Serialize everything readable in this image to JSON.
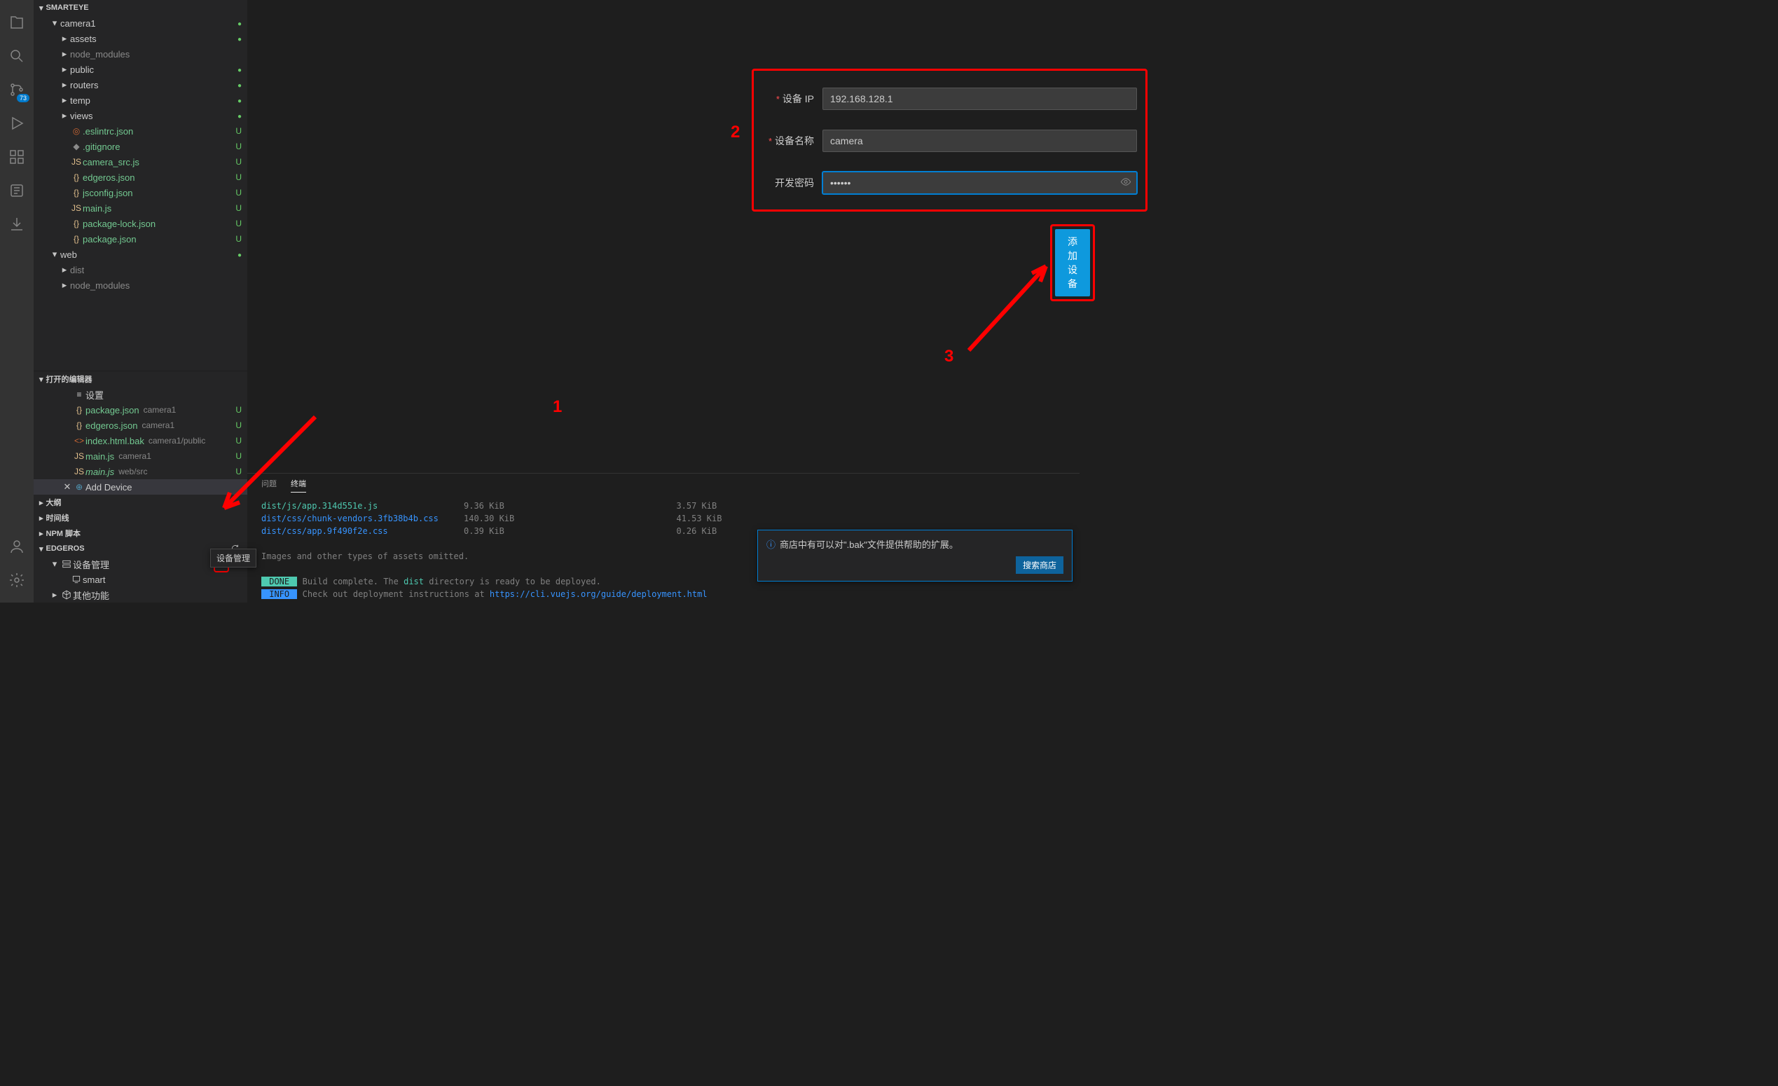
{
  "activity": {
    "source_control_badge": "73"
  },
  "annotations": {
    "n1": "1",
    "n2": "2",
    "n3": "3"
  },
  "explorer": {
    "root_name": "SMARTEYE",
    "tree": [
      {
        "depth": 1,
        "expand": "down",
        "label": "camera1",
        "status": "dot"
      },
      {
        "depth": 2,
        "expand": "right",
        "label": "assets",
        "status": "dot"
      },
      {
        "depth": 2,
        "expand": "right",
        "label": "node_modules",
        "cls": "clr-gray"
      },
      {
        "depth": 2,
        "expand": "right",
        "label": "public",
        "status": "dot"
      },
      {
        "depth": 2,
        "expand": "right",
        "label": "routers",
        "status": "dot"
      },
      {
        "depth": 2,
        "expand": "right",
        "label": "temp",
        "status": "dot"
      },
      {
        "depth": 2,
        "expand": "right",
        "label": "views",
        "status": "dot"
      },
      {
        "depth": 2,
        "icon": "◎",
        "iconcls": "clr-orange",
        "label": ".eslintrc.json",
        "status": "U",
        "cls": "clr-green"
      },
      {
        "depth": 2,
        "icon": "◆",
        "iconcls": "clr-gray",
        "label": ".gitignore",
        "status": "U",
        "cls": "clr-green"
      },
      {
        "depth": 2,
        "icon": "JS",
        "iconcls": "clr-yellow",
        "label": "camera_src.js",
        "status": "U",
        "cls": "clr-green"
      },
      {
        "depth": 2,
        "icon": "{}",
        "iconcls": "clr-bracket",
        "label": "edgeros.json",
        "status": "U",
        "cls": "clr-green"
      },
      {
        "depth": 2,
        "icon": "{}",
        "iconcls": "clr-bracket",
        "label": "jsconfig.json",
        "status": "U",
        "cls": "clr-green"
      },
      {
        "depth": 2,
        "icon": "JS",
        "iconcls": "clr-yellow",
        "label": "main.js",
        "status": "U",
        "cls": "clr-green"
      },
      {
        "depth": 2,
        "icon": "{}",
        "iconcls": "clr-bracket",
        "label": "package-lock.json",
        "status": "U",
        "cls": "clr-green"
      },
      {
        "depth": 2,
        "icon": "{}",
        "iconcls": "clr-bracket",
        "label": "package.json",
        "status": "U",
        "cls": "clr-green"
      },
      {
        "depth": 1,
        "expand": "down",
        "label": "web",
        "status": "dot"
      },
      {
        "depth": 2,
        "expand": "right",
        "label": "dist",
        "cls": "clr-gray"
      },
      {
        "depth": 2,
        "expand": "right",
        "label": "node_modules",
        "cls": "clr-gray"
      }
    ]
  },
  "open_editors": {
    "header": "打开的编辑器",
    "items": [
      {
        "icon": "≡",
        "label": "设置"
      },
      {
        "icon": "{}",
        "iconcls": "clr-bracket",
        "label": "package.json",
        "sub": "camera1",
        "status": "U",
        "cls": "clr-green"
      },
      {
        "icon": "{}",
        "iconcls": "clr-bracket",
        "label": "edgeros.json",
        "sub": "camera1",
        "status": "U",
        "cls": "clr-green"
      },
      {
        "icon": "<>",
        "iconcls": "clr-orange",
        "label": "index.html.bak",
        "sub": "camera1/public",
        "status": "U",
        "cls": "clr-green"
      },
      {
        "icon": "JS",
        "iconcls": "clr-yellow",
        "label": "main.js",
        "sub": "camera1",
        "status": "U",
        "cls": "clr-green"
      },
      {
        "icon": "JS",
        "iconcls": "clr-yellow",
        "italic": true,
        "label": "main.js",
        "sub": "web/src",
        "status": "U",
        "cls": "clr-green"
      },
      {
        "close": true,
        "icon": "⊕",
        "iconcls": "clr-blue",
        "label": "Add Device",
        "active": true
      }
    ]
  },
  "outline": {
    "header": "大纲"
  },
  "timeline": {
    "header": "时间线"
  },
  "npm": {
    "header": "NPM 脚本"
  },
  "edgeros": {
    "header": "EDGEROS",
    "device_mgmt": "设备管理",
    "device_item": "smart",
    "other": "其他功能",
    "tooltip": "设备管理"
  },
  "form": {
    "ip_label": "设备 IP",
    "ip_value": "192.168.128.1",
    "name_label": "设备名称",
    "name_value": "camera",
    "pwd_label": "开发密码",
    "pwd_value": "••••••",
    "submit": "添加设备",
    "star": "*"
  },
  "terminal": {
    "tab_problems": "问题",
    "tab_terminal": "终端",
    "line1a": "dist/js/app.314d551e.js",
    "line1b": "9.36 KiB",
    "line1c": "3.57 KiB",
    "line2a": "dist/css/chunk-vendors.3fb38b4b.css",
    "line2b": "140.30 KiB",
    "line2c": "41.53 KiB",
    "line3a": "dist/css/app.9f490f2e.css",
    "line3b": "0.39 KiB",
    "line3c": "0.26 KiB",
    "omitted": "Images and other types of assets omitted.",
    "done_label": " DONE ",
    "done_text1": "Build complete. The ",
    "done_text_dist": "dist",
    "done_text2": " directory is ready to be deployed.",
    "info_label": " INFO ",
    "info_text": "Check out deployment instructions at ",
    "info_link": "https://cli.vuejs.org/guide/deployment.html"
  },
  "toast": {
    "text": "商店中有可以对\".bak\"文件提供帮助的扩展。",
    "button": "搜索商店"
  }
}
